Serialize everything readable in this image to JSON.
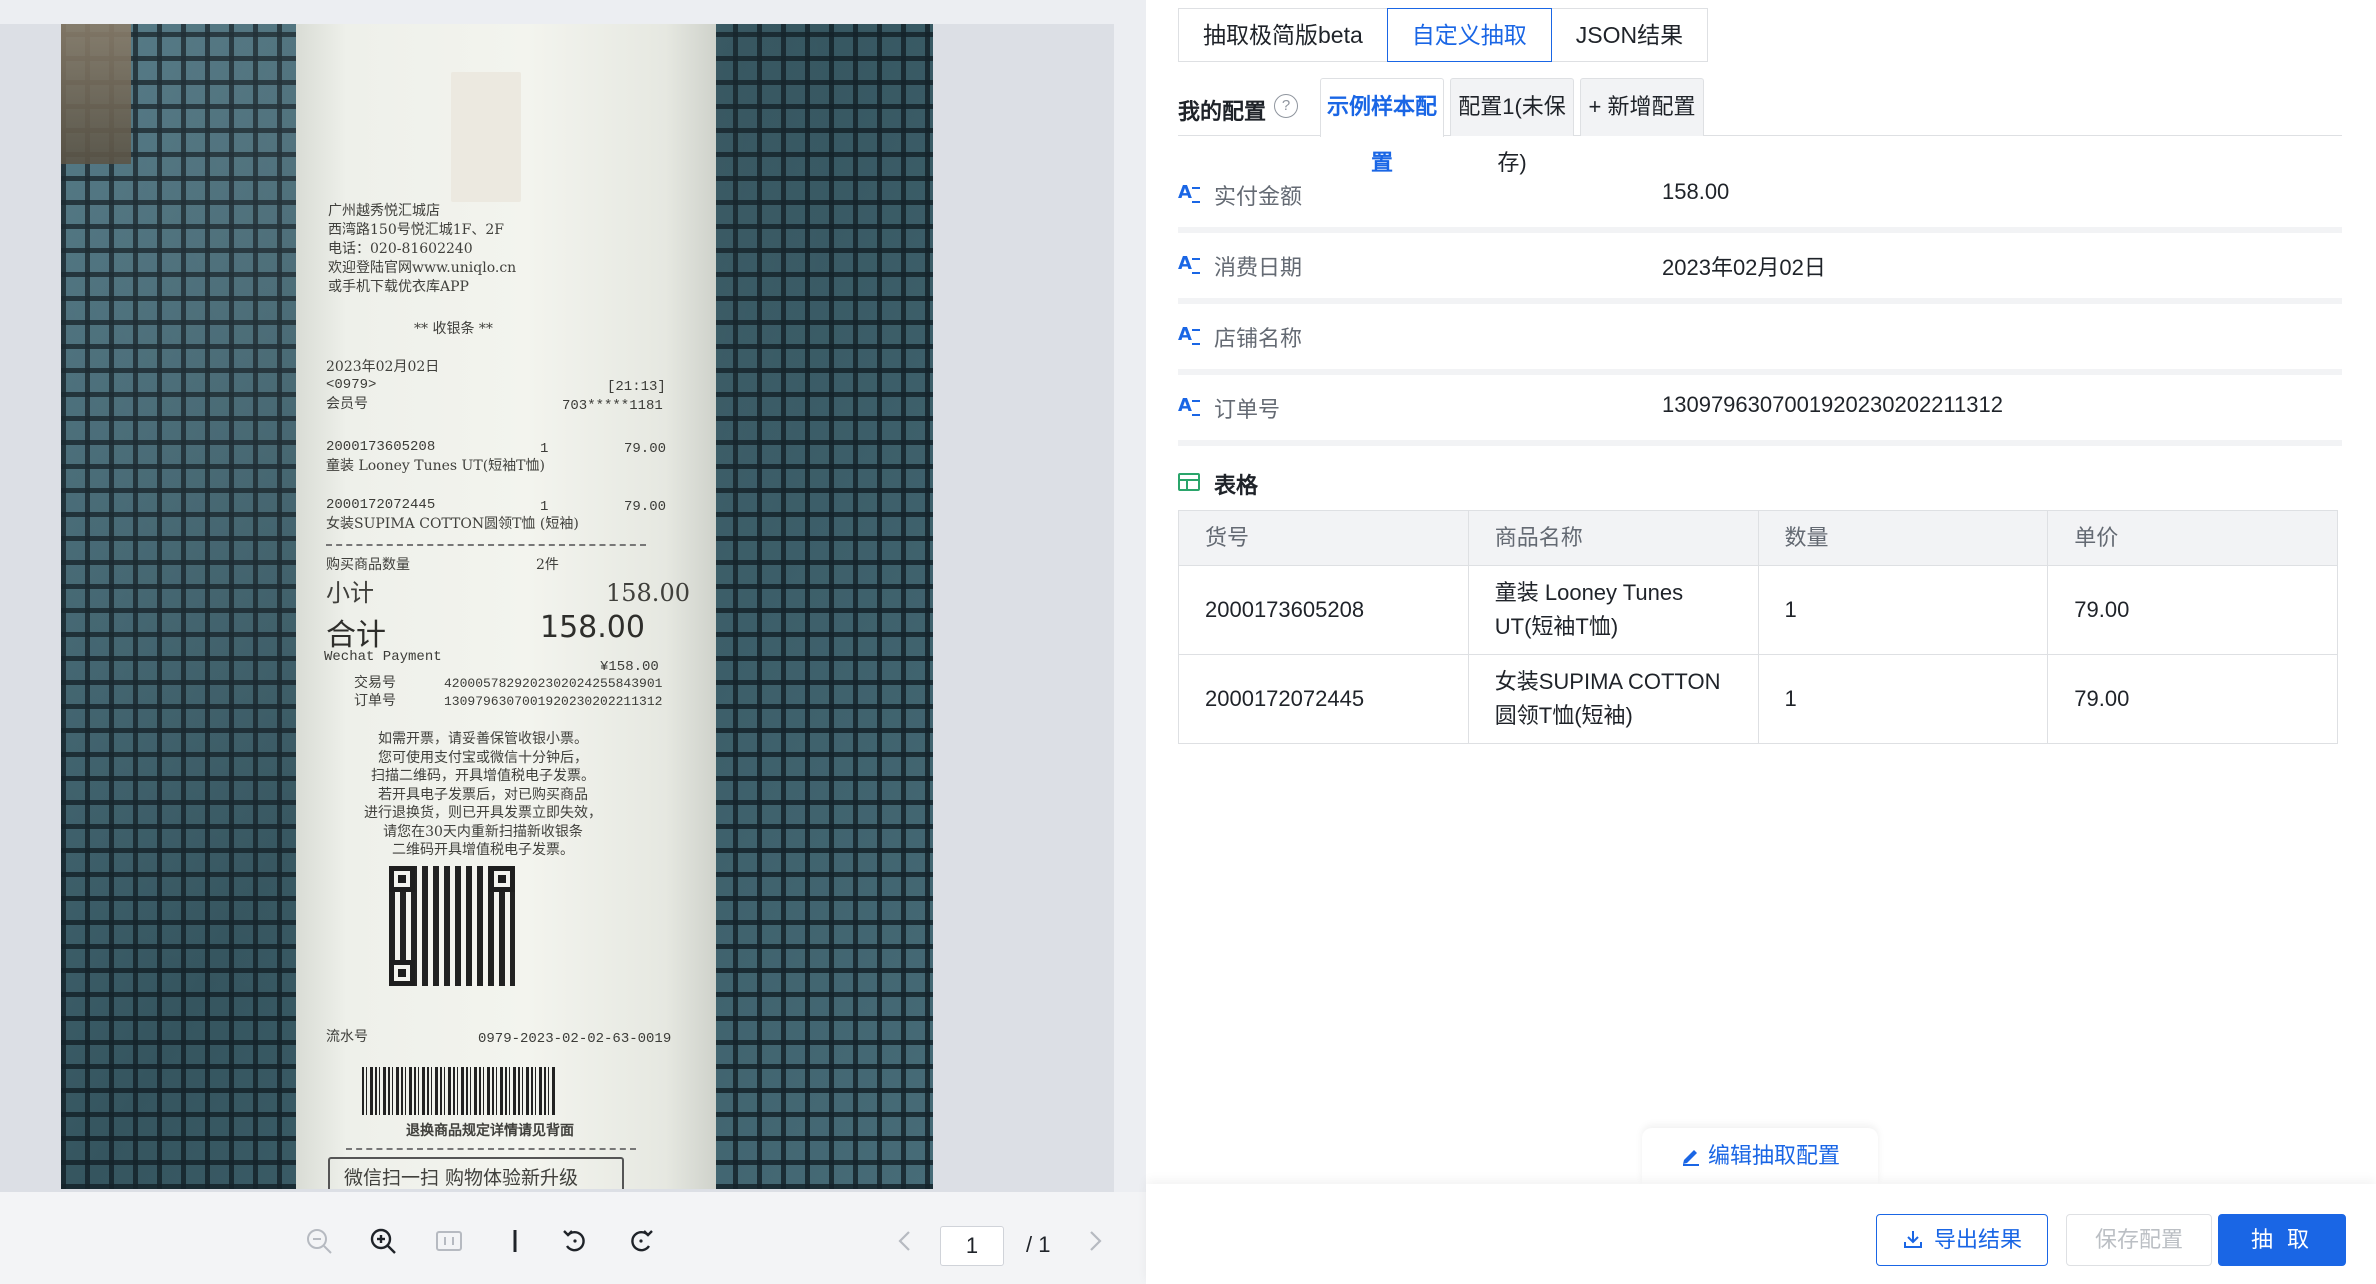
{
  "receipt": {
    "store_lines": [
      "广州越秀悦汇城店",
      "西湾路150号悦汇城1F、2F",
      "电话：020-81602240",
      "欢迎登陆官网www.uniqlo.cn",
      "或手机下载优衣库APP"
    ],
    "heading": "** 收银条 **",
    "date": "2023年02月02日",
    "code": "<0979>",
    "time": "[21:13]",
    "member_label": "会员号",
    "member_no": "703*****1181",
    "item1_no": "2000173605208",
    "item1_qty": "1",
    "item1_price": "79.00",
    "item1_name": "童装 Looney Tunes UT(短袖T恤)",
    "item2_no": "2000172072445",
    "item2_qty": "1",
    "item2_price": "79.00",
    "item2_name": "女装SUPIMA COTTON圆领T恤 (短袖)",
    "count_label": "购买商品数量",
    "count_value": "2件",
    "subtotal_label": "小计",
    "subtotal_value": "158.00",
    "total_label": "合计",
    "total_value": "158.00",
    "payment_label": "Wechat Payment",
    "payment_value": "¥158.00",
    "txn_label": "交易号",
    "txn_value": "4200057829202302024255843901",
    "order_label": "订单号",
    "order_value": "1309796307001920230202211312",
    "notice": "如需开票，请妥善保管收银小票。\n您可使用支付宝或微信十分钟后，\n扫描二维码，开具增值税电子发票。\n若开具电子发票后，对已购买商品\n进行退换货，则已开具发票立即失效，\n请您在30天内重新扫描新收银条\n二维码开具增值税电子发票。",
    "serial_label": "流水号",
    "serial_value": "0979-2023-02-02-63-0019",
    "return_note": "退换商品规定详情请见背面",
    "banner": "微信扫一扫 购物体验新升级"
  },
  "viewer": {
    "page_current": "1",
    "page_total": "/ 1",
    "icons": [
      "zoom-out-icon",
      "zoom-in-icon",
      "actual-size-icon",
      "cursor-icon",
      "rotate-left-icon",
      "rotate-right-icon",
      "prev-page-icon",
      "next-page-icon"
    ]
  },
  "tabs": [
    "抽取极简版beta",
    "自定义抽取",
    "JSON结果"
  ],
  "active_tab": "自定义抽取",
  "config": {
    "label": "我的配置",
    "tabs": [
      "示例样本配置",
      "配置1(未保存)",
      "+  新增配置"
    ]
  },
  "fields": [
    {
      "name": "实付金额",
      "value": "158.00"
    },
    {
      "name": "消费日期",
      "value": "2023年02月02日"
    },
    {
      "name": "店铺名称",
      "value": ""
    },
    {
      "name": "订单号",
      "value": "1309796307001920230202211312"
    }
  ],
  "table": {
    "title": "表格",
    "headers": [
      "货号",
      "商品名称",
      "数量",
      "单价"
    ],
    "rows": [
      [
        "2000173605208",
        "童装 Looney Tunes UT(短袖T恤)",
        "1",
        "79.00"
      ],
      [
        "2000172072445",
        "女装SUPIMA COTTON 圆领T恤(短袖)",
        "1",
        "79.00"
      ]
    ]
  },
  "footer": {
    "edit_label": "编辑抽取配置",
    "export_label": "导出结果",
    "save_label": "保存配置",
    "run_label": "抽 取"
  },
  "colors": {
    "accent": "#1a66e5",
    "table_icon": "#2aa56b",
    "disabled": "#bbbfc4"
  }
}
